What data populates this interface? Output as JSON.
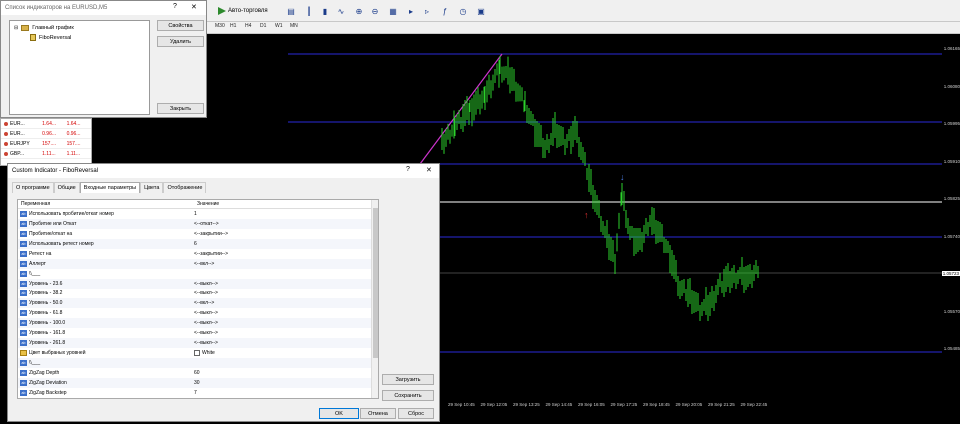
{
  "toolbar": {
    "autotrade_label": "Авто-торговля",
    "periods": [
      "M5",
      "M30",
      "H1",
      "H4",
      "D1",
      "W1",
      "MN"
    ]
  },
  "indicators_dialog": {
    "title": "Список индикаторов на EURUSD,M5",
    "tree_root": "Главный график",
    "tree_child": "FiboReversal",
    "btn_props": "Свойства",
    "btn_delete": "Удалить",
    "btn_close": "Закрыть",
    "help": "?",
    "close_x": "✕"
  },
  "market_watch": {
    "rows": [
      {
        "symbol": "EUR...",
        "bid": "1.64...",
        "ask": "1.64..."
      },
      {
        "symbol": "EUR...",
        "bid": "0.96...",
        "ask": "0.96..."
      },
      {
        "symbol": "EURJPY",
        "bid": "157....",
        "ask": "157...."
      },
      {
        "symbol": "GBP...",
        "bid": "1.11...",
        "ask": "1.11..."
      }
    ]
  },
  "custom_dialog": {
    "title": "Custom Indicator - FiboReversal",
    "help": "?",
    "close_x": "✕",
    "tabs": [
      "О программе",
      "Общие",
      "Входные параметры",
      "Цвета",
      "Отображение"
    ],
    "col_var": "Переменная",
    "col_val": "Значение",
    "params": [
      {
        "name": "Использовать пробитие/откат номер",
        "value": "1",
        "icon": "ab"
      },
      {
        "name": "Пробитие или Откат",
        "value": "<--откат-->",
        "icon": "ab"
      },
      {
        "name": "Пробитие/откат на",
        "value": "<--закрытии-->",
        "icon": "ab"
      },
      {
        "name": "Использовать ретест номер",
        "value": "6",
        "icon": "ab"
      },
      {
        "name": "Ретест на",
        "value": "<--закрытии-->",
        "icon": "ab"
      },
      {
        "name": "Аллерт",
        "value": "<--вкл-->",
        "icon": "ab"
      },
      {
        "name": "\\\\___",
        "value": "",
        "icon": "ab"
      },
      {
        "name": "Уровень - 23.6",
        "value": "<--выкл-->",
        "icon": "ab"
      },
      {
        "name": "Уровень - 38.2",
        "value": "<--выкл-->",
        "icon": "ab"
      },
      {
        "name": "Уровень - 50.0",
        "value": "<--вкл-->",
        "icon": "ab"
      },
      {
        "name": "Уровень - 61.8",
        "value": "<--выкл-->",
        "icon": "ab"
      },
      {
        "name": "Уровень - 100.0",
        "value": "<--выкл-->",
        "icon": "ab"
      },
      {
        "name": "Уровень - 161.8",
        "value": "<--выкл-->",
        "icon": "ab"
      },
      {
        "name": "Уровень - 261.8",
        "value": "<--выкл-->",
        "icon": "ab"
      },
      {
        "name": "Цвет выбраных уровней",
        "value": "White",
        "icon": "pal",
        "swatch": true
      },
      {
        "name": "\\\\___",
        "value": "",
        "icon": "ab"
      },
      {
        "name": "ZigZag Depth",
        "value": "60",
        "icon": "ab"
      },
      {
        "name": "ZigZag Deviation",
        "value": "30",
        "icon": "ab"
      },
      {
        "name": "ZigZag Backstep",
        "value": "7",
        "icon": "ab"
      }
    ],
    "btn_load": "Загрузить",
    "btn_save": "Сохранить",
    "btn_ok": "OK",
    "btn_cancel": "Отмена",
    "btn_reset": "Сброс"
  },
  "chart": {
    "prices": [
      "1.06165",
      "1.06080",
      "1.05995",
      "1.05910",
      "1.05825",
      "1.05740",
      "1.05655",
      "1.05570",
      "1.05485"
    ],
    "current_price": "1.05723",
    "times": [
      "29 Sep 10:45",
      "29 Sep 12:05",
      "29 Sep 13:25",
      "29 Sep 14:45",
      "29 Sep 16:05",
      "29 Sep 17:25",
      "29 Sep 18:45",
      "29 Sep 20:05",
      "29 Sep 21:25",
      "29 Sep 22:45"
    ],
    "colors": {
      "bars": "#2bd12b",
      "levels": "#2a2ad8",
      "trend": "#cc33cc",
      "white_level": "#ffffff",
      "up_arrow": "#e03030",
      "down_arrow": "#4a7be0"
    }
  }
}
